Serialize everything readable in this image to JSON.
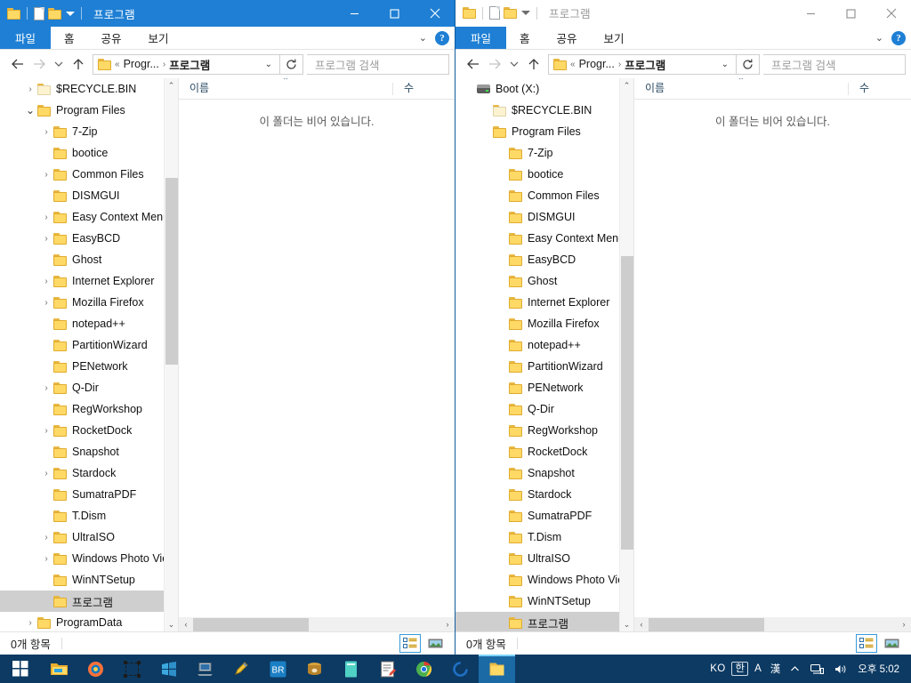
{
  "windows": [
    {
      "id": "left",
      "active": true,
      "title": "프로그램",
      "quick_access": [
        "folder-icon",
        "document-icon",
        "folder-icon",
        "chevron-down-icon"
      ],
      "window_buttons": {
        "minimize": "minimize-icon",
        "maximize": "maximize-icon",
        "close": "close-icon"
      },
      "ribbon_tabs": [
        {
          "label": "파일",
          "selected": true
        },
        {
          "label": "홈",
          "selected": false
        },
        {
          "label": "공유",
          "selected": false
        },
        {
          "label": "보기",
          "selected": false
        }
      ],
      "ribbon_help": "?",
      "address": {
        "back": "back-arrow-icon",
        "forward": "forward-arrow-icon",
        "recent": "chevron-down-icon",
        "up": "up-arrow-icon",
        "crumbs": [
          "«",
          "Progr...",
          "프로그램"
        ],
        "refresh": "refresh-icon",
        "search_placeholder": "프로그램 검색",
        "search_value": ""
      },
      "tree": [
        {
          "label": "$RECYCLE.BIN",
          "indent": 1,
          "chev": "closed",
          "icon": "folder-pale-icon",
          "selected": false
        },
        {
          "label": "Program Files",
          "indent": 1,
          "chev": "open",
          "icon": "folder-icon",
          "selected": false
        },
        {
          "label": "7-Zip",
          "indent": 2,
          "chev": "closed",
          "icon": "folder-icon",
          "selected": false
        },
        {
          "label": "bootice",
          "indent": 2,
          "chev": "none",
          "icon": "folder-icon",
          "selected": false
        },
        {
          "label": "Common Files",
          "indent": 2,
          "chev": "closed",
          "icon": "folder-icon",
          "selected": false
        },
        {
          "label": "DISMGUI",
          "indent": 2,
          "chev": "none",
          "icon": "folder-icon",
          "selected": false
        },
        {
          "label": "Easy Context Menu",
          "indent": 2,
          "chev": "closed",
          "icon": "folder-icon",
          "selected": false
        },
        {
          "label": "EasyBCD",
          "indent": 2,
          "chev": "closed",
          "icon": "folder-icon",
          "selected": false
        },
        {
          "label": "Ghost",
          "indent": 2,
          "chev": "none",
          "icon": "folder-icon",
          "selected": false
        },
        {
          "label": "Internet Explorer",
          "indent": 2,
          "chev": "closed",
          "icon": "folder-icon",
          "selected": false
        },
        {
          "label": "Mozilla Firefox",
          "indent": 2,
          "chev": "closed",
          "icon": "folder-icon",
          "selected": false
        },
        {
          "label": "notepad++",
          "indent": 2,
          "chev": "none",
          "icon": "folder-icon",
          "selected": false
        },
        {
          "label": "PartitionWizard",
          "indent": 2,
          "chev": "none",
          "icon": "folder-icon",
          "selected": false
        },
        {
          "label": "PENetwork",
          "indent": 2,
          "chev": "none",
          "icon": "folder-icon",
          "selected": false
        },
        {
          "label": "Q-Dir",
          "indent": 2,
          "chev": "closed",
          "icon": "folder-icon",
          "selected": false
        },
        {
          "label": "RegWorkshop",
          "indent": 2,
          "chev": "none",
          "icon": "folder-icon",
          "selected": false
        },
        {
          "label": "RocketDock",
          "indent": 2,
          "chev": "closed",
          "icon": "folder-icon",
          "selected": false
        },
        {
          "label": "Snapshot",
          "indent": 2,
          "chev": "none",
          "icon": "folder-icon",
          "selected": false
        },
        {
          "label": "Stardock",
          "indent": 2,
          "chev": "closed",
          "icon": "folder-icon",
          "selected": false
        },
        {
          "label": "SumatraPDF",
          "indent": 2,
          "chev": "none",
          "icon": "folder-icon",
          "selected": false
        },
        {
          "label": "T.Dism",
          "indent": 2,
          "chev": "none",
          "icon": "folder-icon",
          "selected": false
        },
        {
          "label": "UltraISO",
          "indent": 2,
          "chev": "closed",
          "icon": "folder-icon",
          "selected": false
        },
        {
          "label": "Windows Photo Viewer",
          "indent": 2,
          "chev": "closed",
          "icon": "folder-icon",
          "selected": false
        },
        {
          "label": "WinNTSetup",
          "indent": 2,
          "chev": "none",
          "icon": "folder-icon",
          "selected": false
        },
        {
          "label": "프로그램",
          "indent": 2,
          "chev": "none",
          "icon": "folder-icon",
          "selected": true
        },
        {
          "label": "ProgramData",
          "indent": 1,
          "chev": "closed",
          "icon": "folder-icon",
          "selected": false
        }
      ],
      "columns": [
        {
          "label": "이름",
          "sorted": "asc"
        },
        {
          "label": "수",
          "sorted": "none"
        }
      ],
      "empty_message": "이 폴더는 비어 있습니다.",
      "status": {
        "items": "0개 항목",
        "view_details": "details-view-icon",
        "view_tiles": "large-icons-view-icon",
        "active_view": "details"
      }
    },
    {
      "id": "right",
      "active": false,
      "title": "프로그램",
      "quick_access": [
        "folder-icon",
        "document-icon",
        "folder-icon",
        "chevron-down-icon"
      ],
      "window_buttons": {
        "minimize": "minimize-icon",
        "maximize": "maximize-icon",
        "close": "close-icon"
      },
      "ribbon_tabs": [
        {
          "label": "파일",
          "selected": true
        },
        {
          "label": "홈",
          "selected": false
        },
        {
          "label": "공유",
          "selected": false
        },
        {
          "label": "보기",
          "selected": false
        }
      ],
      "ribbon_help": "?",
      "address": {
        "back": "back-arrow-icon",
        "forward": "forward-arrow-icon",
        "recent": "chevron-down-icon",
        "up": "up-arrow-icon",
        "crumbs": [
          "«",
          "Progr...",
          "프로그램"
        ],
        "refresh": "refresh-icon",
        "search_placeholder": "프로그램 검색",
        "search_value": ""
      },
      "tree": [
        {
          "label": "Boot (X:)",
          "indent": 0,
          "chev": "none",
          "icon": "drive-icon",
          "selected": false
        },
        {
          "label": "$RECYCLE.BIN",
          "indent": 1,
          "chev": "none",
          "icon": "folder-pale-icon",
          "selected": false
        },
        {
          "label": "Program Files",
          "indent": 1,
          "chev": "none",
          "icon": "folder-icon",
          "selected": false
        },
        {
          "label": "7-Zip",
          "indent": 2,
          "chev": "none",
          "icon": "folder-icon",
          "selected": false
        },
        {
          "label": "bootice",
          "indent": 2,
          "chev": "none",
          "icon": "folder-icon",
          "selected": false
        },
        {
          "label": "Common Files",
          "indent": 2,
          "chev": "none",
          "icon": "folder-icon",
          "selected": false
        },
        {
          "label": "DISMGUI",
          "indent": 2,
          "chev": "none",
          "icon": "folder-icon",
          "selected": false
        },
        {
          "label": "Easy Context Menu",
          "indent": 2,
          "chev": "none",
          "icon": "folder-icon",
          "selected": false
        },
        {
          "label": "EasyBCD",
          "indent": 2,
          "chev": "none",
          "icon": "folder-icon",
          "selected": false
        },
        {
          "label": "Ghost",
          "indent": 2,
          "chev": "none",
          "icon": "folder-icon",
          "selected": false
        },
        {
          "label": "Internet Explorer",
          "indent": 2,
          "chev": "none",
          "icon": "folder-icon",
          "selected": false
        },
        {
          "label": "Mozilla Firefox",
          "indent": 2,
          "chev": "none",
          "icon": "folder-icon",
          "selected": false
        },
        {
          "label": "notepad++",
          "indent": 2,
          "chev": "none",
          "icon": "folder-icon",
          "selected": false
        },
        {
          "label": "PartitionWizard",
          "indent": 2,
          "chev": "none",
          "icon": "folder-icon",
          "selected": false
        },
        {
          "label": "PENetwork",
          "indent": 2,
          "chev": "none",
          "icon": "folder-icon",
          "selected": false
        },
        {
          "label": "Q-Dir",
          "indent": 2,
          "chev": "none",
          "icon": "folder-icon",
          "selected": false
        },
        {
          "label": "RegWorkshop",
          "indent": 2,
          "chev": "none",
          "icon": "folder-icon",
          "selected": false
        },
        {
          "label": "RocketDock",
          "indent": 2,
          "chev": "none",
          "icon": "folder-icon",
          "selected": false
        },
        {
          "label": "Snapshot",
          "indent": 2,
          "chev": "none",
          "icon": "folder-icon",
          "selected": false
        },
        {
          "label": "Stardock",
          "indent": 2,
          "chev": "none",
          "icon": "folder-icon",
          "selected": false
        },
        {
          "label": "SumatraPDF",
          "indent": 2,
          "chev": "none",
          "icon": "folder-icon",
          "selected": false
        },
        {
          "label": "T.Dism",
          "indent": 2,
          "chev": "none",
          "icon": "folder-icon",
          "selected": false
        },
        {
          "label": "UltraISO",
          "indent": 2,
          "chev": "none",
          "icon": "folder-icon",
          "selected": false
        },
        {
          "label": "Windows Photo Viewer",
          "indent": 2,
          "chev": "none",
          "icon": "folder-icon",
          "selected": false
        },
        {
          "label": "WinNTSetup",
          "indent": 2,
          "chev": "none",
          "icon": "folder-icon",
          "selected": false
        },
        {
          "label": "프로그램",
          "indent": 2,
          "chev": "none",
          "icon": "folder-icon",
          "selected": true
        }
      ],
      "columns": [
        {
          "label": "이름",
          "sorted": "asc"
        },
        {
          "label": "수",
          "sorted": "none"
        }
      ],
      "empty_message": "이 폴더는 비어 있습니다.",
      "status": {
        "items": "0개 항목",
        "view_details": "details-view-icon",
        "view_tiles": "large-icons-view-icon",
        "active_view": "details"
      }
    }
  ],
  "taskbar": {
    "start": "windows-start-icon",
    "items": [
      {
        "name": "file-explorer-icon",
        "active": false
      },
      {
        "name": "firefox-icon",
        "active": false
      },
      {
        "name": "snipping-tool-icon",
        "active": false
      },
      {
        "name": "windows-logo-blue-icon",
        "active": false
      },
      {
        "name": "remote-desktop-icon",
        "active": false
      },
      {
        "name": "paint-tool-icon",
        "active": false
      },
      {
        "name": "br-app-icon",
        "active": false
      },
      {
        "name": "archive-app-icon",
        "active": false
      },
      {
        "name": "teal-app-icon",
        "active": false
      },
      {
        "name": "notepad-icon",
        "active": false
      },
      {
        "name": "chrome-icon",
        "active": false
      },
      {
        "name": "blue-circle-app-icon",
        "active": false
      },
      {
        "name": "explorer-window-icon",
        "active": true
      }
    ],
    "tray": {
      "lang": "KO",
      "ime_hangul": "한",
      "ime_alpha": "A",
      "ime_hanja": "漢",
      "overflow": "chevron-up-icon",
      "network": "network-icon",
      "volume": "volume-icon",
      "clock": "오후 5:02"
    }
  },
  "colors": {
    "accent": "#1e7fd4",
    "titlebar_active": "#1e7fd4",
    "taskbar": "#0c3a63",
    "selection": "#cfcfcf",
    "folder": "#ffd966"
  }
}
